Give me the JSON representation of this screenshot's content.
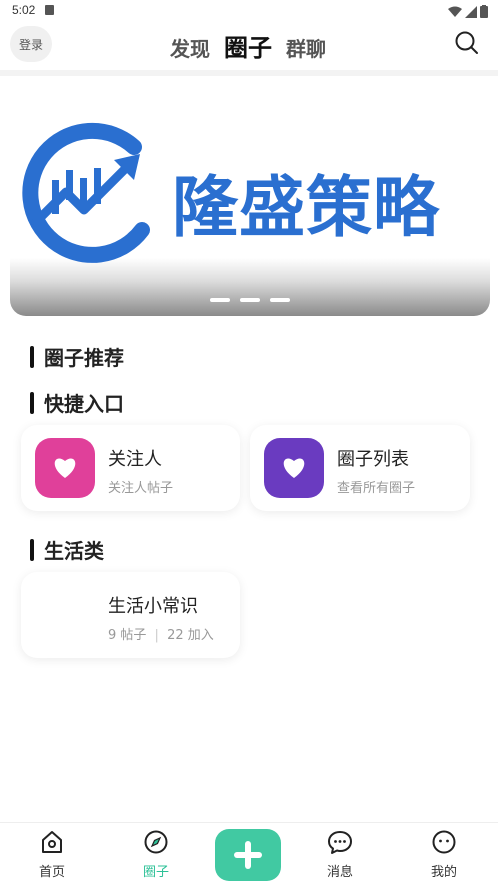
{
  "status_bar": {
    "time": "5:02"
  },
  "header": {
    "login_label": "登录",
    "tabs": [
      {
        "label": "发现",
        "active": false
      },
      {
        "label": "圈子",
        "active": true
      },
      {
        "label": "群聊",
        "active": false
      }
    ]
  },
  "banner": {
    "title": "隆盛策略",
    "brand_color": "#2a6fd0",
    "page_count": 3,
    "current_page": 2
  },
  "sections": {
    "recommended_title": "圈子推荐",
    "shortcuts_title": "快捷入口",
    "life_title": "生活类"
  },
  "shortcuts": [
    {
      "name": "关注人",
      "sub": "关注人帖子",
      "color": "#e0409a",
      "icon": "heart-icon"
    },
    {
      "name": "圈子列表",
      "sub": "查看所有圈子",
      "color": "#6a3bc0",
      "icon": "heart-icon"
    }
  ],
  "life_circles": [
    {
      "name": "生活小常识",
      "posts": "9 帖子",
      "members": "22 加入"
    }
  ],
  "bottom_nav": {
    "accent": "#2cc197",
    "items": [
      {
        "label": "首页",
        "icon": "home-icon"
      },
      {
        "label": "圈子",
        "icon": "compass-icon",
        "active": true
      },
      {
        "label": "",
        "icon": "plus-icon"
      },
      {
        "label": "消息",
        "icon": "chat-icon"
      },
      {
        "label": "我的",
        "icon": "smile-icon"
      }
    ]
  }
}
